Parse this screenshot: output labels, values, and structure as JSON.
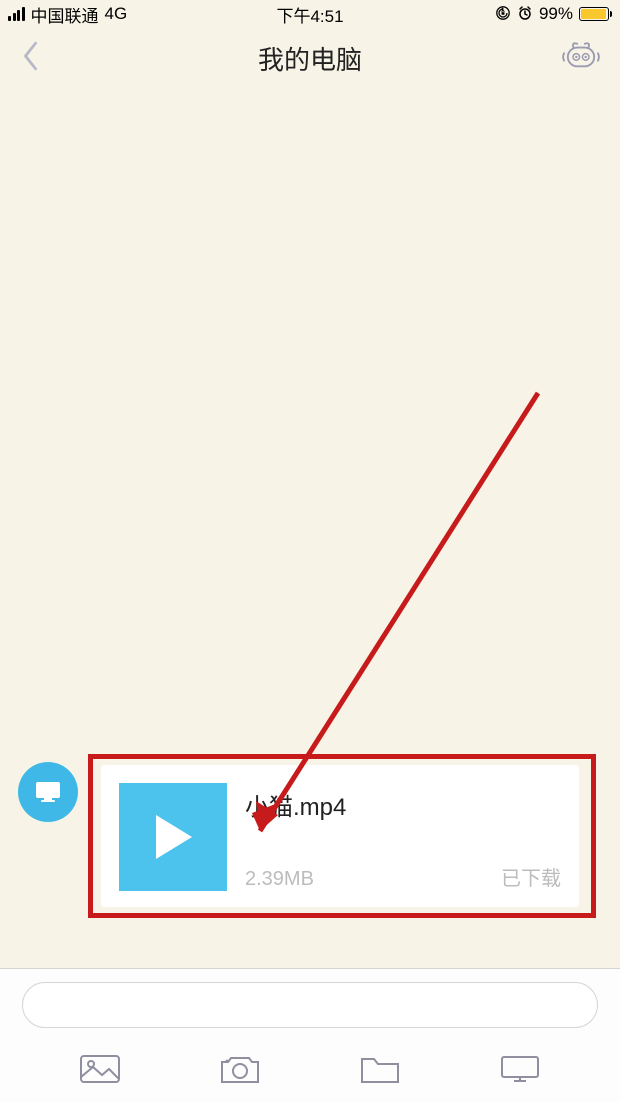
{
  "status_bar": {
    "carrier": "中国联通",
    "network": "4G",
    "time": "下午4:51",
    "battery_percent": "99%"
  },
  "header": {
    "title": "我的电脑"
  },
  "file_message": {
    "name": "小猫.mp4",
    "size": "2.39MB",
    "status": "已下载"
  }
}
